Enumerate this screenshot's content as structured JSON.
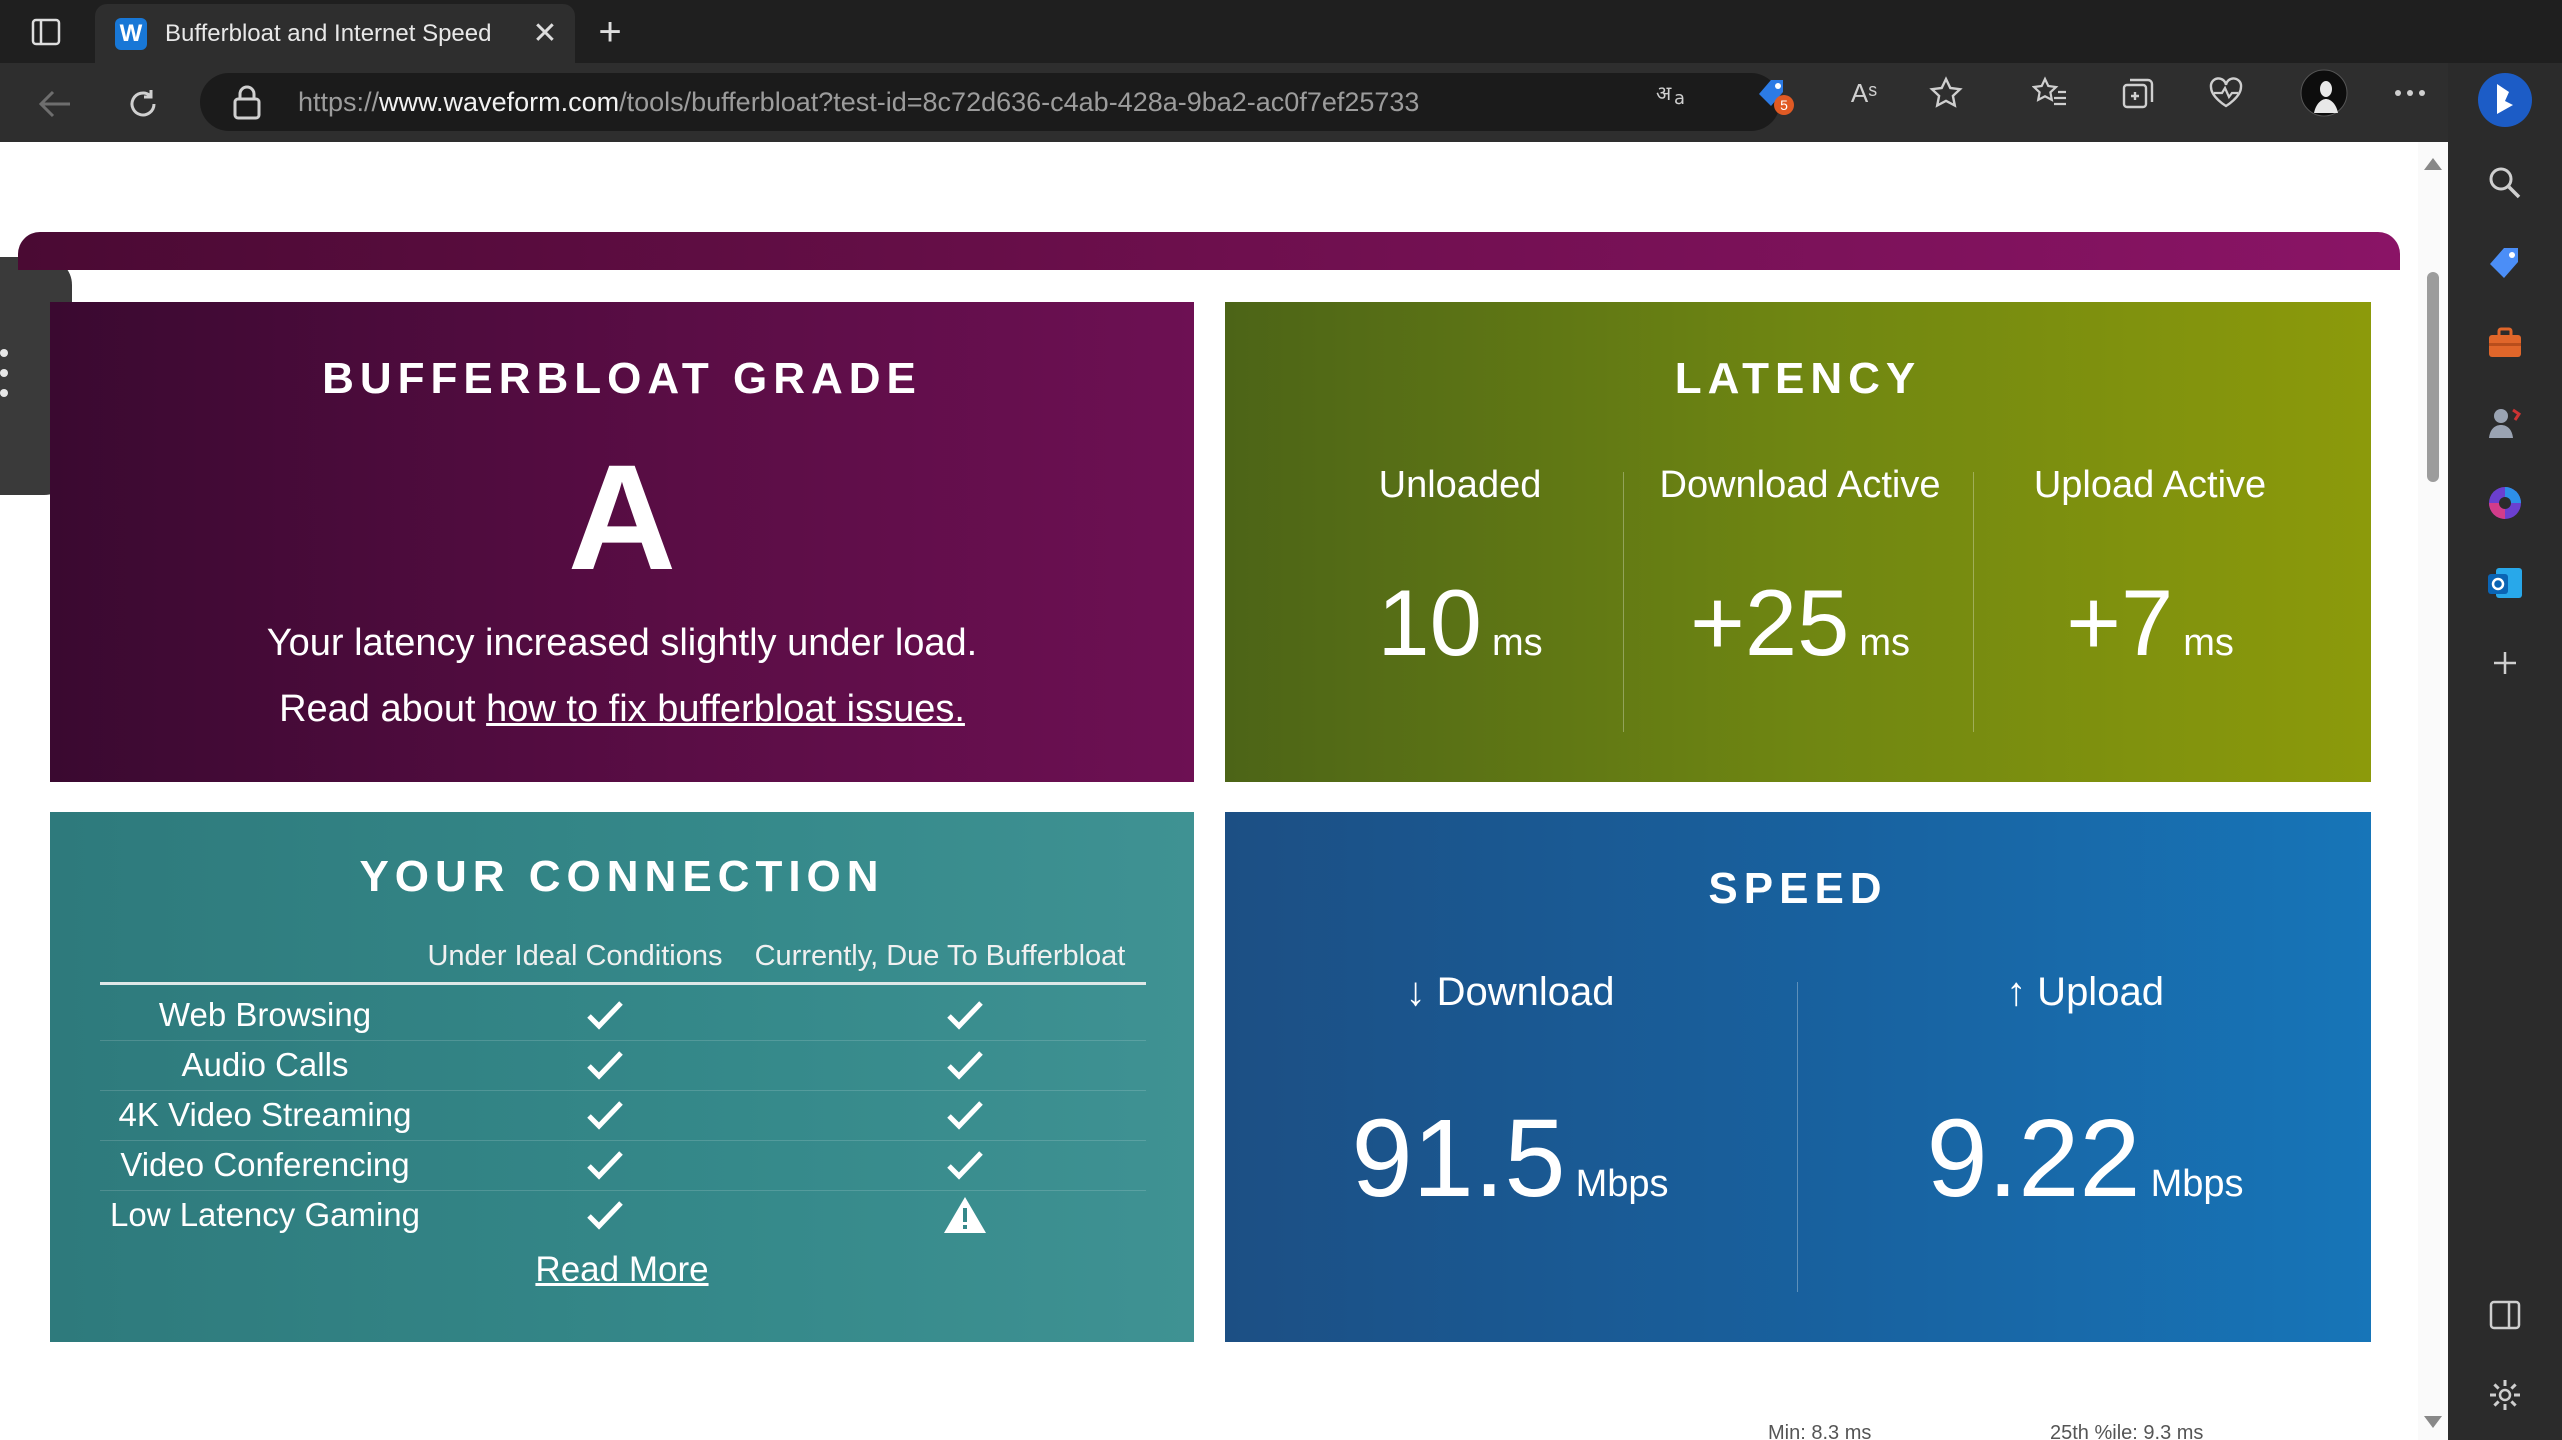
{
  "browser": {
    "tab_title": "Bufferbloat and Internet Speed",
    "favicon_letter": "W",
    "url_prefix": "https://",
    "url_domain": "www.waveform.com",
    "url_path": "/tools/bufferbloat?test-id=8c72d636-c4ab-428a-9ba2-ac0f7ef25733",
    "shopping_badge": "5",
    "read_aloud_label": "Aˢ"
  },
  "grade": {
    "title": "BUFFERBLOAT GRADE",
    "letter": "A",
    "line1": "Your latency increased slightly under load.",
    "line2_prefix": "Read about ",
    "line2_link": "how to fix bufferbloat issues."
  },
  "latency": {
    "title": "LATENCY",
    "columns": [
      {
        "label": "Unloaded",
        "value": "10",
        "unit": "ms"
      },
      {
        "label": "Download Active",
        "value": "+25",
        "unit": "ms"
      },
      {
        "label": "Upload Active",
        "value": "+7",
        "unit": "ms"
      }
    ]
  },
  "connection": {
    "title": "YOUR CONNECTION",
    "col_ideal": "Under Ideal Conditions",
    "col_current": "Currently, Due To Bufferbloat",
    "rows": [
      {
        "name": "Web Browsing",
        "ideal": "check",
        "current": "check"
      },
      {
        "name": "Audio Calls",
        "ideal": "check",
        "current": "check"
      },
      {
        "name": "4K Video Streaming",
        "ideal": "check",
        "current": "check"
      },
      {
        "name": "Video Conferencing",
        "ideal": "check",
        "current": "check"
      },
      {
        "name": "Low Latency Gaming",
        "ideal": "check",
        "current": "warning"
      }
    ],
    "read_more": "Read More"
  },
  "speed": {
    "title": "SPEED",
    "download_label": "↓ Download",
    "download_value": "91.5",
    "upload_label": "↑ Upload",
    "upload_value": "9.22",
    "unit": "Mbps"
  },
  "footer": {
    "min_text": "Min: 8.3 ms",
    "pct_text": "25th %ile: 9.3 ms"
  }
}
